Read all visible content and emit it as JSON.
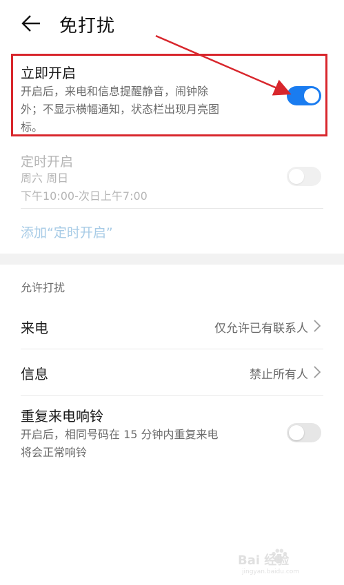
{
  "header": {
    "title": "免打扰"
  },
  "immediate": {
    "title": "立即开启",
    "desc_line1": "开启后，来电和信息提醒静音，闹钟除",
    "desc_line2": "外；不显示横幅通知，状态栏出现月亮图",
    "desc_line3": "标。",
    "toggle": "on"
  },
  "scheduled": {
    "title": "定时开启",
    "days": "周六 周日",
    "time": "下午10:00-次日上午7:00",
    "toggle": "off"
  },
  "add_schedule": {
    "label": "添加“定时开启”"
  },
  "allow_section": {
    "label": "允许打扰",
    "items": [
      {
        "label": "来电",
        "value": "仅允许已有联系人"
      },
      {
        "label": "信息",
        "value": "禁止所有人"
      }
    ]
  },
  "repeat_call": {
    "title": "重复来电响铃",
    "desc_line1": "开启后，相同号码在 15 分钟内重复来电",
    "desc_line2": "将会正常响铃",
    "toggle": "off"
  },
  "watermark": {
    "text": "Bai 经验",
    "url": "jingyan.baidu.com"
  },
  "colors": {
    "accent": "#1a7cf0",
    "annotation": "#d8262c",
    "disabled_text": "#b5b5b5",
    "link": "#a7cbe6"
  }
}
